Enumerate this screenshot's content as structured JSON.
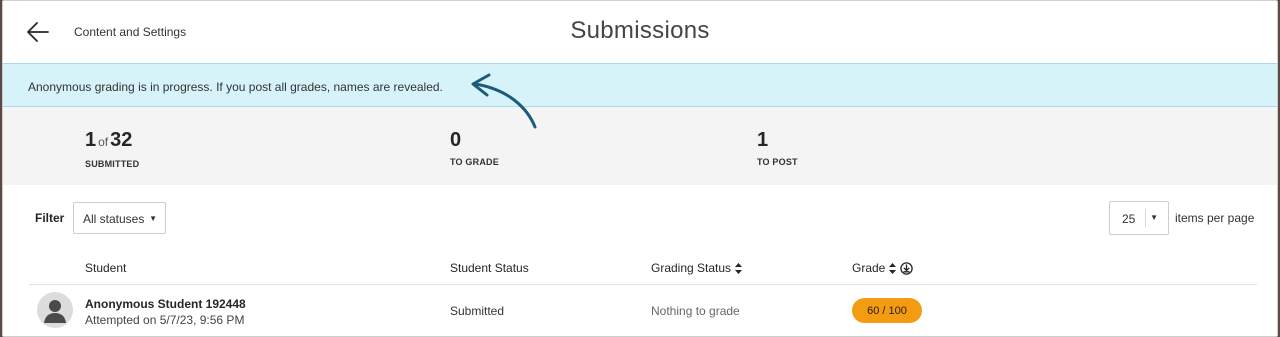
{
  "header": {
    "back_icon": "arrow-left-icon",
    "breadcrumb": "Content and Settings",
    "title": "Submissions"
  },
  "banner": {
    "message": "Anonymous grading is in progress. If you post all grades, names are revealed."
  },
  "stats": {
    "submitted": {
      "count": "1",
      "of": "of",
      "total": "32",
      "label": "SUBMITTED"
    },
    "to_grade": {
      "count": "0",
      "label": "TO GRADE"
    },
    "to_post": {
      "count": "1",
      "label": "TO POST"
    }
  },
  "filter": {
    "label": "Filter",
    "value": "All statuses"
  },
  "pagination": {
    "per_page": "25",
    "label": "items per page"
  },
  "table": {
    "columns": {
      "student": "Student",
      "student_status": "Student Status",
      "grading_status": "Grading Status",
      "grade": "Grade"
    },
    "rows": [
      {
        "name": "Anonymous Student 192448",
        "attempted": "Attempted on 5/7/23, 9:56 PM",
        "student_status": "Submitted",
        "grading_status": "Nothing to grade",
        "grade": "60  / 100"
      }
    ]
  },
  "colors": {
    "banner_bg": "#d6f3fa",
    "grade_pill": "#f39c12",
    "arrow": "#1f5a7a"
  }
}
